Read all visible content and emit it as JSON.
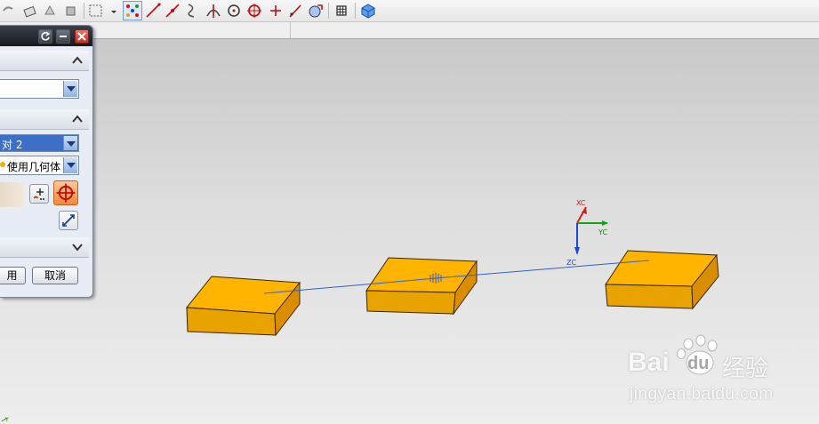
{
  "toolbar": {
    "icons": [
      "undo-icon",
      "eraser-icon",
      "move-icon",
      "tweak-icon",
      "select-box-icon",
      "dropdown-icon",
      "snap-points-icon",
      "line-icon",
      "point-line-icon",
      "curve-icon",
      "intersect-icon",
      "circle-center-icon",
      "circle-icon",
      "cross-icon",
      "tangent-icon",
      "view-icon",
      "grid-icon",
      "cube-icon"
    ]
  },
  "dialog": {
    "combo_top": "",
    "combo_selected": "对 2",
    "combo_method": "使用几何体",
    "apply_label": "用",
    "cancel_label": "取消"
  },
  "csys": {
    "x_label": "XC",
    "y_label": "YC",
    "z_label": "ZC"
  },
  "corner_label": "Y",
  "watermark": {
    "brand": "Bai",
    "brand2": "du",
    "product": "经验",
    "url": "jingyan.baidu.com"
  },
  "colors": {
    "block_top": "#ffb400",
    "block_side": "#d98d00",
    "block_front": "#e8a300",
    "axis_line": "#3060d0"
  }
}
